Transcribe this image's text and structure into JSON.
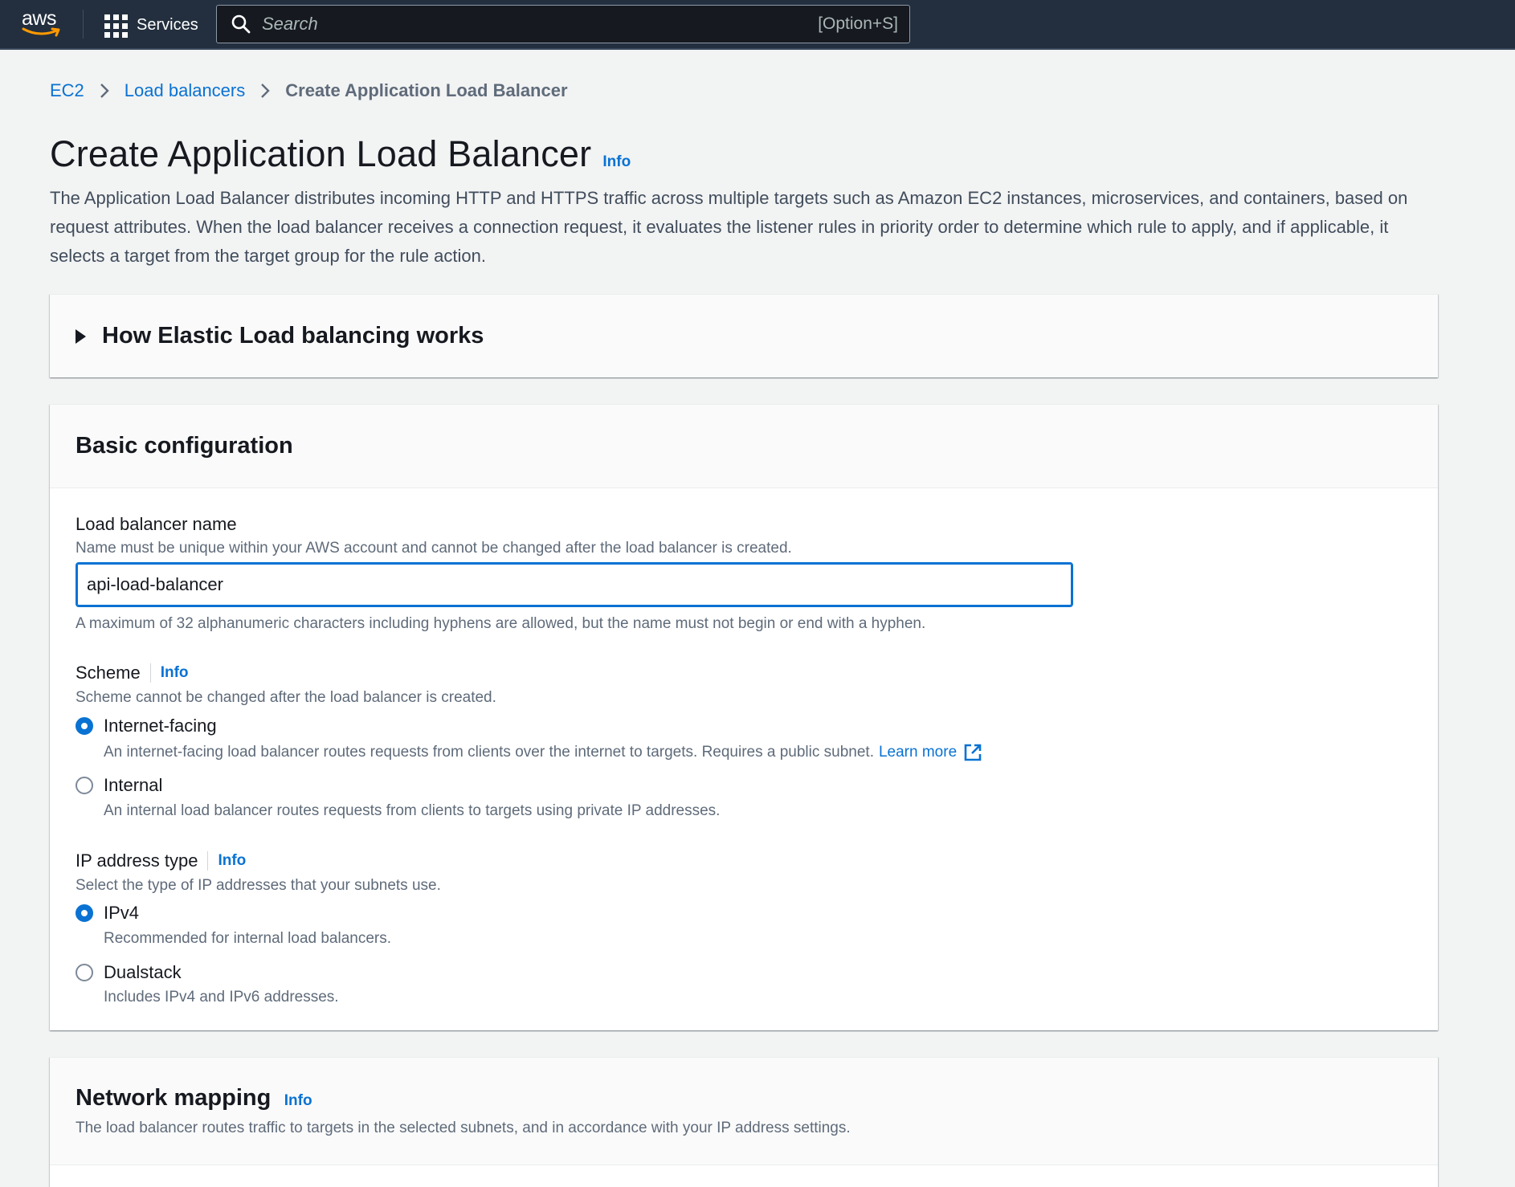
{
  "topbar": {
    "logo_text": "aws",
    "services_label": "Services",
    "search_placeholder": "Search",
    "search_shortcut": "[Option+S]"
  },
  "breadcrumb": {
    "items": [
      "EC2",
      "Load balancers"
    ],
    "current": "Create Application Load Balancer"
  },
  "page": {
    "title": "Create Application Load Balancer",
    "info_label": "Info",
    "description": "The Application Load Balancer distributes incoming HTTP and HTTPS traffic across multiple targets such as Amazon EC2 instances, microservices, and containers, based on request attributes. When the load balancer receives a connection request, it evaluates the listener rules in priority order to determine which rule to apply, and if applicable, it selects a target from the target group for the rule action."
  },
  "expander": {
    "title": "How Elastic Load balancing works"
  },
  "basic_config": {
    "title": "Basic configuration",
    "name_field": {
      "label": "Load balancer name",
      "description": "Name must be unique within your AWS account and cannot be changed after the load balancer is created.",
      "value": "api-load-balancer",
      "constraint": "A maximum of 32 alphanumeric characters including hyphens are allowed, but the name must not begin or end with a hyphen."
    },
    "scheme": {
      "label": "Scheme",
      "info_label": "Info",
      "description": "Scheme cannot be changed after the load balancer is created.",
      "options": [
        {
          "label": "Internet-facing",
          "description": "An internet-facing load balancer routes requests from clients over the internet to targets. Requires a public subnet.",
          "link": "Learn more",
          "checked": true
        },
        {
          "label": "Internal",
          "description": "An internal load balancer routes requests from clients to targets using private IP addresses.",
          "checked": false
        }
      ]
    },
    "ip_type": {
      "label": "IP address type",
      "info_label": "Info",
      "description": "Select the type of IP addresses that your subnets use.",
      "options": [
        {
          "label": "IPv4",
          "description": "Recommended for internal load balancers.",
          "checked": true
        },
        {
          "label": "Dualstack",
          "description": "Includes IPv4 and IPv6 addresses.",
          "checked": false
        }
      ]
    }
  },
  "network_mapping": {
    "title": "Network mapping",
    "info_label": "Info",
    "description": "The load balancer routes traffic to targets in the selected subnets, and in accordance with your IP address settings."
  },
  "colors": {
    "topbar": "#232f3e",
    "link": "#0972d3",
    "text": "#16191f",
    "muted": "#5f6b7a"
  }
}
